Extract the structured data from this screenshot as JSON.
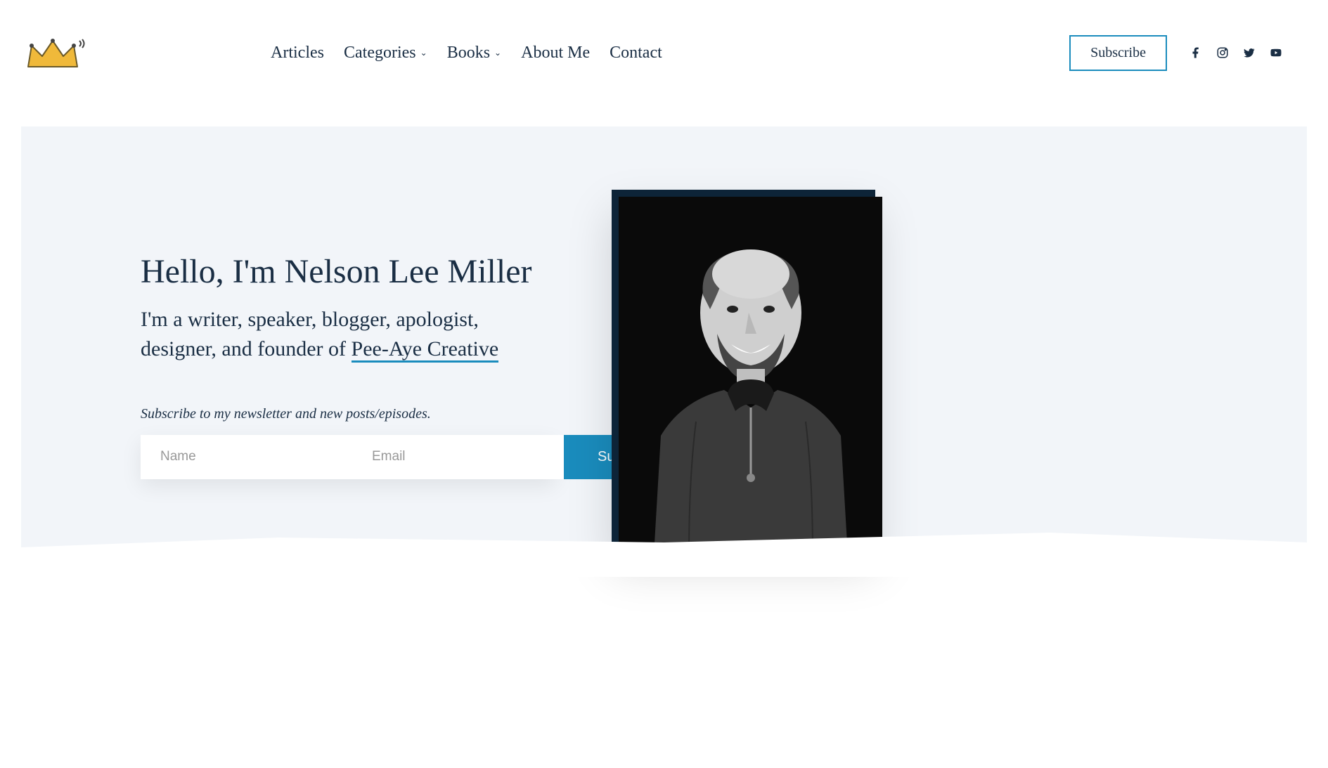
{
  "nav": {
    "items": [
      {
        "label": "Articles",
        "dropdown": false
      },
      {
        "label": "Categories",
        "dropdown": true
      },
      {
        "label": "Books",
        "dropdown": true
      },
      {
        "label": "About Me",
        "dropdown": false
      },
      {
        "label": "Contact",
        "dropdown": false
      }
    ],
    "subscribe_label": "Subscribe"
  },
  "hero": {
    "title": "Hello, I'm Nelson Lee Miller",
    "subtitle_prefix": "I'm a writer, speaker, blogger, apologist, designer, and founder of ",
    "subtitle_link": "Pee-Aye Creative",
    "newsletter_label": "Subscribe to my newsletter and new posts/episodes.",
    "name_placeholder": "Name",
    "email_placeholder": "Email",
    "subscribe_button": "Subscribe"
  },
  "colors": {
    "navy": "#1a2e44",
    "accent": "#1a8cbd",
    "hero_bg": "#f2f5f9"
  },
  "social": [
    "facebook",
    "instagram",
    "twitter",
    "youtube"
  ]
}
